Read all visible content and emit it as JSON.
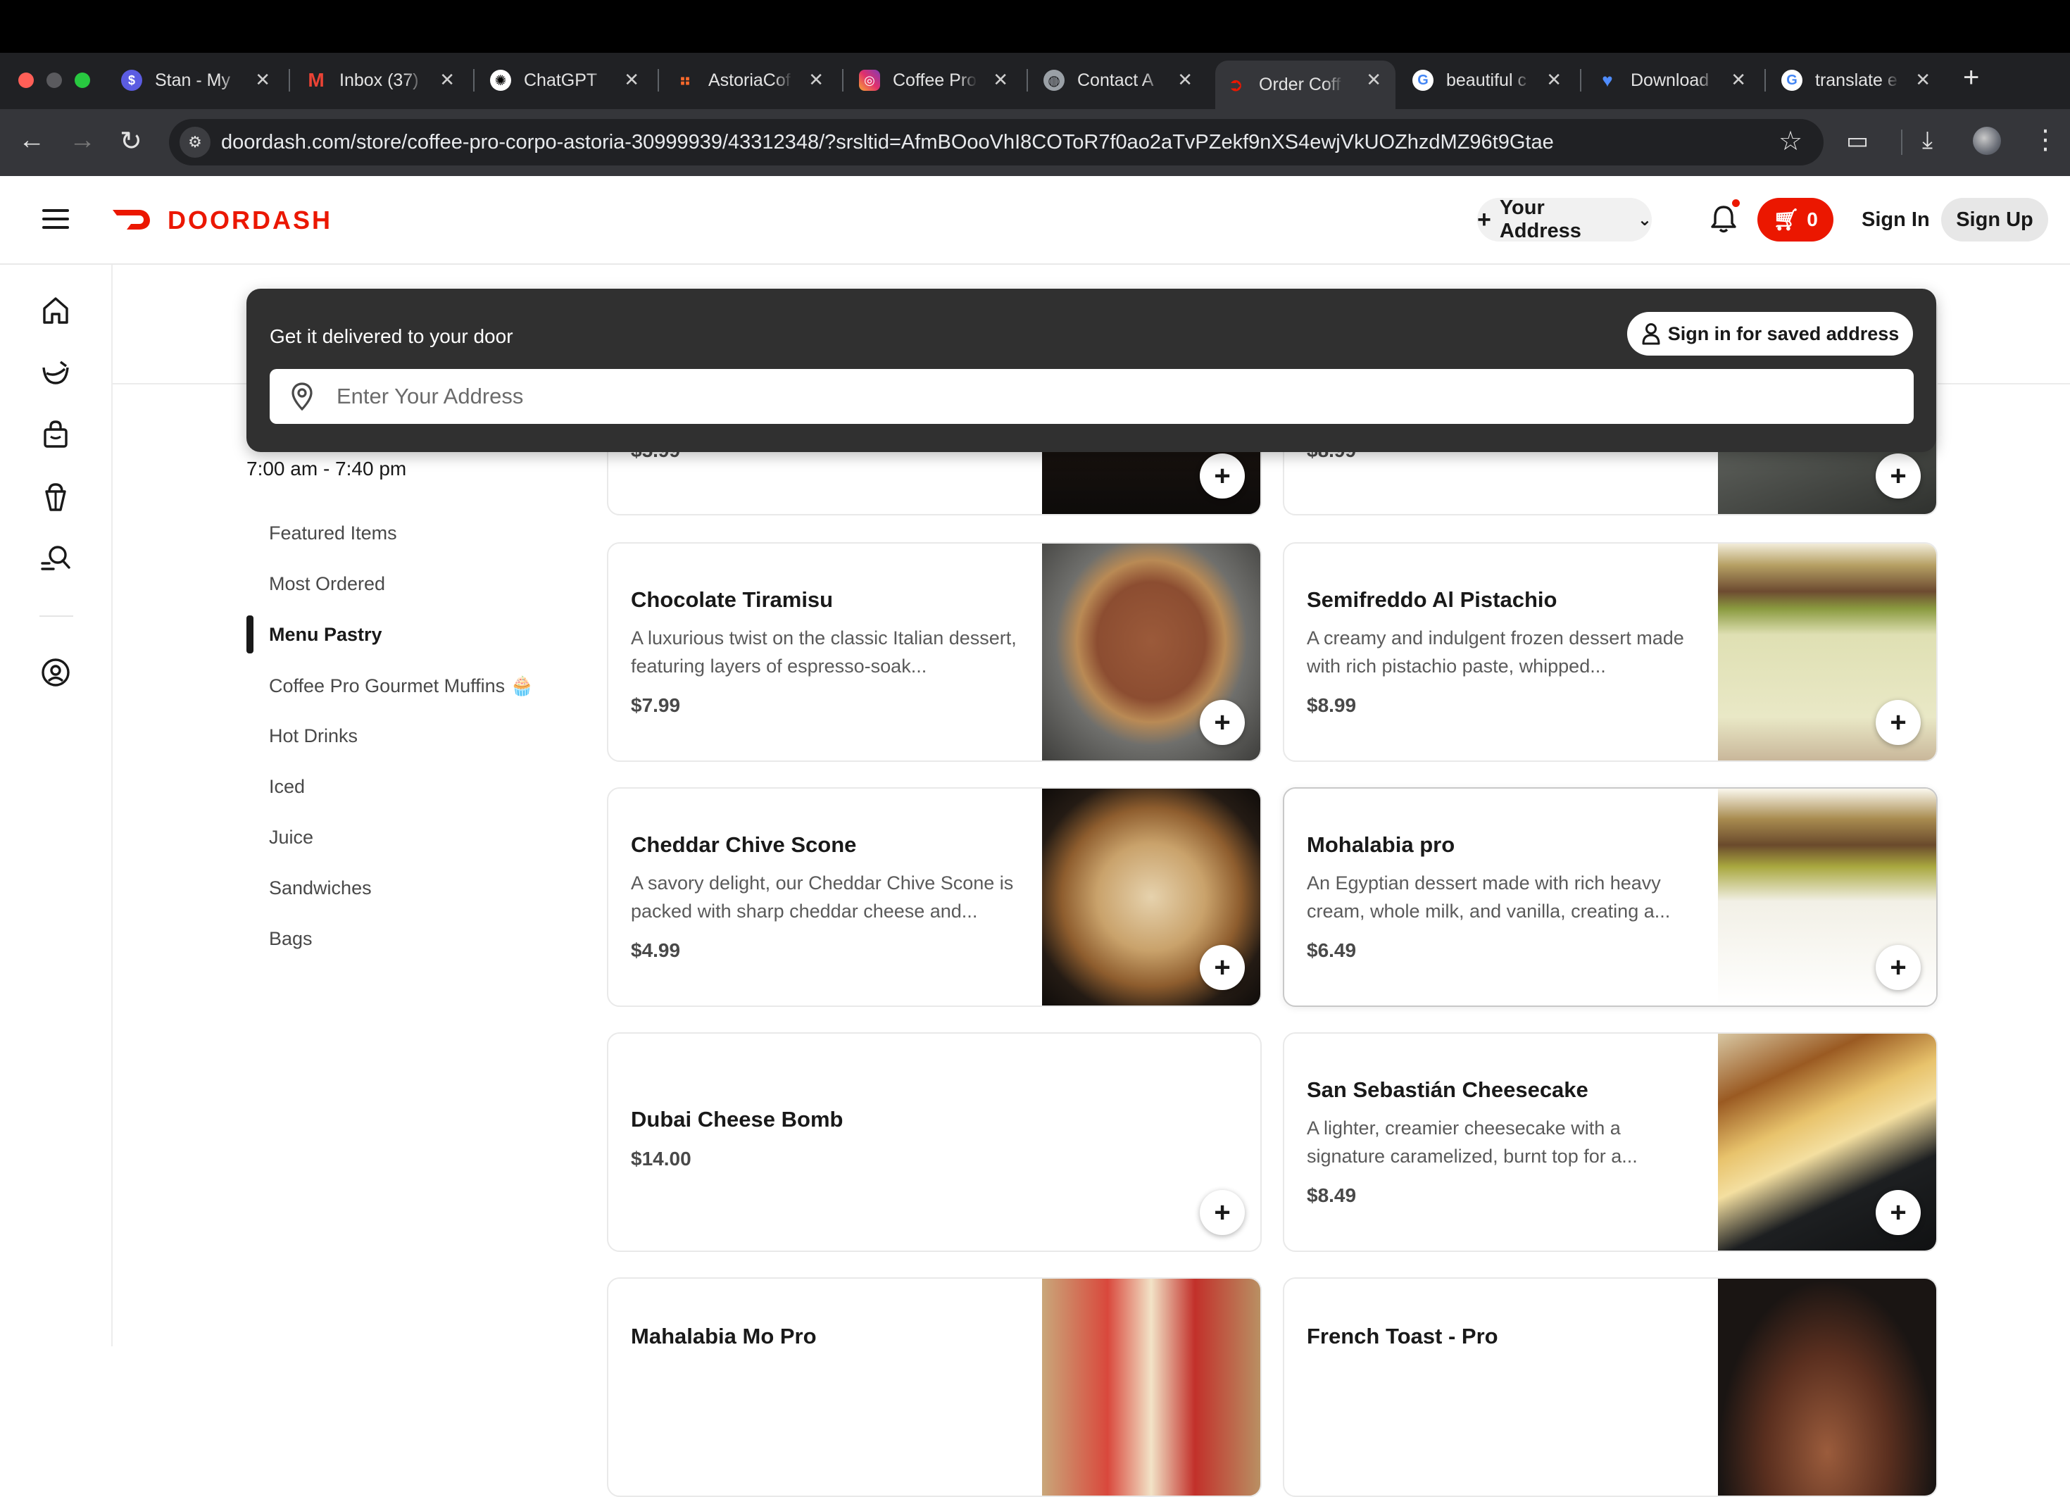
{
  "browser": {
    "tabs": [
      {
        "label": "Stan - My",
        "icon": "stan-favicon"
      },
      {
        "label": "Inbox (37)",
        "icon": "gmail-favicon"
      },
      {
        "label": "ChatGPT",
        "icon": "chatgpt-favicon"
      },
      {
        "label": "AstoriaCof",
        "icon": "astoria-favicon"
      },
      {
        "label": "Coffee Pro",
        "icon": "instagram-favicon"
      },
      {
        "label": "Contact A",
        "icon": "globe-favicon"
      },
      {
        "label": "Order Coff",
        "icon": "doordash-favicon",
        "active": true
      },
      {
        "label": "beautiful c",
        "icon": "google-favicon"
      },
      {
        "label": "Download",
        "icon": "heart-favicon"
      },
      {
        "label": "translate e",
        "icon": "google-favicon"
      }
    ],
    "url": "doordash.com/store/coffee-pro-corpo-astoria-30999939/43312348/?srsltid=AfmBOooVhI8COToR7f0ao2aTvPZekf9nXS4ewjVkUOZhzdMZ96t9Gtae"
  },
  "header": {
    "brand": "DOORDASH",
    "address_button": "Your Address",
    "cart_count": "0",
    "sign_in": "Sign In",
    "sign_up": "Sign Up",
    "brand_color": "#eb1700"
  },
  "rail": {
    "icons": [
      "home-icon",
      "grocery-icon",
      "retail-icon",
      "convenience-icon",
      "search-icon",
      "account-icon"
    ]
  },
  "address_overlay": {
    "title": "Get it delivered to your door",
    "saved_address_button": "Sign in for saved address",
    "input_placeholder": "Enter Your Address"
  },
  "store": {
    "hours": "7:00 am - 7:40 pm",
    "categories": [
      {
        "label": "Featured Items"
      },
      {
        "label": "Most Ordered"
      },
      {
        "label": "Menu Pastry",
        "active": true
      },
      {
        "label": "Coffee Pro Gourmet Muffins 🧁"
      },
      {
        "label": "Hot Drinks"
      },
      {
        "label": "Iced"
      },
      {
        "label": "Juice"
      },
      {
        "label": "Sandwiches"
      },
      {
        "label": "Bags"
      }
    ]
  },
  "items": [
    {
      "name": "",
      "description": "",
      "price": "$5.99"
    },
    {
      "name": "",
      "description": "",
      "price": "$8.99"
    },
    {
      "name": "Chocolate Tiramisu",
      "description": "A luxurious twist on the classic Italian dessert, featuring layers of espresso-soak...",
      "price": "$7.99"
    },
    {
      "name": "Semifreddo Al Pistachio",
      "description": "A creamy and indulgent frozen dessert made with rich pistachio paste, whipped...",
      "price": "$8.99"
    },
    {
      "name": "Cheddar Chive Scone",
      "description": "A savory delight, our Cheddar Chive Scone is packed with sharp cheddar cheese and...",
      "price": "$4.99"
    },
    {
      "name": "Mohalabia pro",
      "description": "An Egyptian dessert made with rich heavy cream, whole milk, and vanilla, creating a...",
      "price": "$6.49"
    },
    {
      "name": "Dubai Cheese Bomb",
      "description": "",
      "price": "$14.00"
    },
    {
      "name": "San Sebastián Cheesecake",
      "description": "A lighter, creamier cheesecake with a signature caramelized, burnt top for a...",
      "price": "$8.49"
    },
    {
      "name": "Mahalabia Mo Pro",
      "description": "",
      "price": ""
    },
    {
      "name": "French Toast - Pro",
      "description": "",
      "price": ""
    }
  ]
}
